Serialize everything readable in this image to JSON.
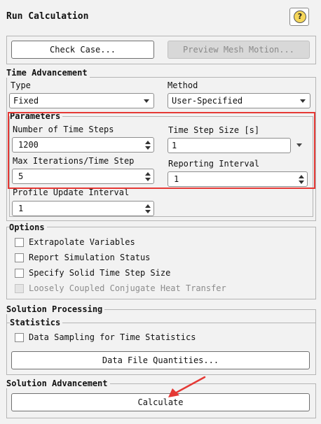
{
  "header": {
    "title": "Run Calculation",
    "help_icon": "help-icon",
    "help_glyph": "?"
  },
  "top_buttons": {
    "check_case": "Check Case...",
    "preview_mesh": "Preview Mesh Motion..."
  },
  "time_advancement": {
    "heading": "Time Advancement",
    "type_label": "Type",
    "type_value": "Fixed",
    "method_label": "Method",
    "method_value": "User-Specified"
  },
  "parameters": {
    "heading": "Parameters",
    "num_steps_label": "Number of Time Steps",
    "num_steps_value": "1200",
    "step_size_label": "Time Step Size [s]",
    "step_size_value": "1",
    "max_iter_label": "Max Iterations/Time Step",
    "max_iter_value": "5",
    "reporting_label": "Reporting Interval",
    "reporting_value": "1",
    "profile_label": "Profile Update Interval",
    "profile_value": "1",
    "highlight_color": "#e53935"
  },
  "options": {
    "heading": "Options",
    "items": [
      {
        "label": "Extrapolate Variables",
        "checked": false,
        "enabled": true
      },
      {
        "label": "Report Simulation Status",
        "checked": false,
        "enabled": true
      },
      {
        "label": "Specify Solid Time Step Size",
        "checked": false,
        "enabled": true
      },
      {
        "label": "Loosely Coupled Conjugate Heat Transfer",
        "checked": false,
        "enabled": false
      }
    ]
  },
  "solution_processing": {
    "heading": "Solution Processing",
    "statistics_heading": "Statistics",
    "data_sampling_label": "Data Sampling for Time Statistics",
    "data_file_button": "Data File Quantities..."
  },
  "solution_advancement": {
    "heading": "Solution Advancement",
    "calculate_button": "Calculate"
  },
  "annotation": {
    "pointer_arrow_color": "#e53935"
  }
}
